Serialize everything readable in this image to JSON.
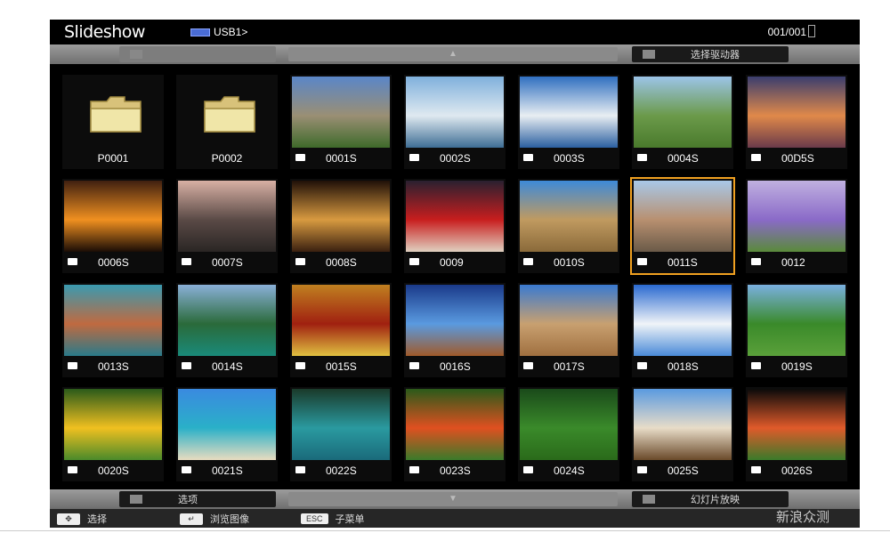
{
  "app": {
    "title": "Slideshow",
    "device": "USB1>",
    "page_counter": "001/001"
  },
  "top_bar": {
    "left_label": "",
    "mid_label": "",
    "right_label": "选择驱动器"
  },
  "bottom_bar": {
    "left_label": "选项",
    "mid_label": "",
    "right_label": "幻灯片放映"
  },
  "items": [
    {
      "type": "folder",
      "name": "P0001"
    },
    {
      "type": "folder",
      "name": "P0002"
    },
    {
      "type": "photo",
      "name": "0001S",
      "colors": [
        "#5a86c8",
        "#9a8f74",
        "#3e6a2a"
      ]
    },
    {
      "type": "photo",
      "name": "0002S",
      "colors": [
        "#7fb0dc",
        "#dfe9f0",
        "#3e6d94"
      ]
    },
    {
      "type": "photo",
      "name": "0003S",
      "colors": [
        "#2f6fc0",
        "#e8eef2",
        "#2b5fa0"
      ]
    },
    {
      "type": "photo",
      "name": "0004S",
      "colors": [
        "#9cc4e8",
        "#6b9a4a",
        "#4a7a2c"
      ]
    },
    {
      "type": "photo",
      "name": "00D5S",
      "colors": [
        "#3a3d6e",
        "#e0894a",
        "#6a3a4a"
      ]
    },
    {
      "type": "photo",
      "name": "0006S",
      "colors": [
        "#402010",
        "#f09020",
        "#1a0c06"
      ]
    },
    {
      "type": "photo",
      "name": "0007S",
      "colors": [
        "#d8b0a4",
        "#5a4a46",
        "#2a2624"
      ]
    },
    {
      "type": "photo",
      "name": "0008S",
      "colors": [
        "#201008",
        "#d89a40",
        "#3a2010"
      ]
    },
    {
      "type": "photo",
      "name": "0009",
      "colors": [
        "#2a2030",
        "#c81e1e",
        "#e0d0c0"
      ]
    },
    {
      "type": "photo",
      "name": "0010S",
      "colors": [
        "#3e8ad8",
        "#c09a60",
        "#8a6a3a"
      ]
    },
    {
      "type": "photo",
      "name": "0011S",
      "colors": [
        "#a8c8e8",
        "#b89070",
        "#6a5a48"
      ]
    },
    {
      "type": "photo",
      "name": "0012",
      "colors": [
        "#c0b0e0",
        "#8a6ac8",
        "#5a8a3a"
      ]
    },
    {
      "type": "photo",
      "name": "0013S",
      "colors": [
        "#3a9ab0",
        "#c06a40",
        "#2a7a8a"
      ]
    },
    {
      "type": "photo",
      "name": "0014S",
      "colors": [
        "#8ab0d8",
        "#2a6a3a",
        "#1a8a7a"
      ]
    },
    {
      "type": "photo",
      "name": "0015S",
      "colors": [
        "#c08020",
        "#a02010",
        "#e0c040"
      ]
    },
    {
      "type": "photo",
      "name": "0016S",
      "colors": [
        "#1a3a8a",
        "#5a9ae0",
        "#a05a2a"
      ]
    },
    {
      "type": "photo",
      "name": "0017S",
      "colors": [
        "#3a7ad0",
        "#c8a070",
        "#a07040"
      ]
    },
    {
      "type": "photo",
      "name": "0018S",
      "colors": [
        "#2a6ad0",
        "#f0f4f8",
        "#4a8ad8"
      ]
    },
    {
      "type": "photo",
      "name": "0019S",
      "colors": [
        "#7ab0e0",
        "#3a8a2a",
        "#5aa03a"
      ]
    },
    {
      "type": "photo",
      "name": "0020S",
      "colors": [
        "#2a5a1a",
        "#f0c020",
        "#4a8a2a"
      ]
    },
    {
      "type": "photo",
      "name": "0021S",
      "colors": [
        "#3a8ae0",
        "#2ab0c8",
        "#e8dcc0"
      ]
    },
    {
      "type": "photo",
      "name": "0022S",
      "colors": [
        "#1a3a2a",
        "#2a9aa0",
        "#1a6a7a"
      ]
    },
    {
      "type": "photo",
      "name": "0023S",
      "colors": [
        "#2a5a1a",
        "#e05020",
        "#3a7a2a"
      ]
    },
    {
      "type": "photo",
      "name": "0024S",
      "colors": [
        "#1a4a1a",
        "#3a8a2a",
        "#2a6a1a"
      ]
    },
    {
      "type": "photo",
      "name": "0025S",
      "colors": [
        "#5a9ae0",
        "#e8dcc8",
        "#6a4a2a"
      ]
    },
    {
      "type": "photo",
      "name": "0026S",
      "colors": [
        "#0a0a0a",
        "#e05a2a",
        "#3a7a2a"
      ]
    }
  ],
  "selected_index": 12,
  "help": {
    "select_label": "选择",
    "browse_label": "浏览图像",
    "sub_menu_label": "子菜单",
    "esc_key": "ESC"
  },
  "watermark": "新浪众测"
}
